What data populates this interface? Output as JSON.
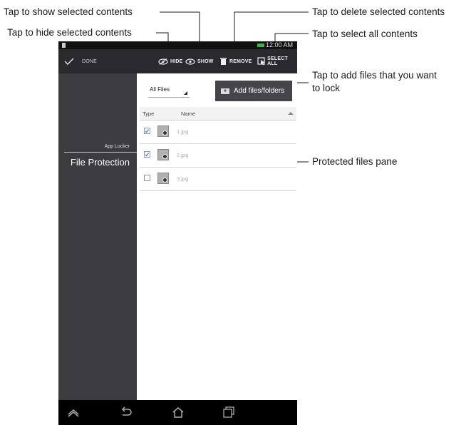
{
  "callouts": {
    "show": "Tap to show selected contents",
    "hide": "Tap to hide selected contents",
    "remove": "Tap to delete selected contents",
    "select_all": "Tap to select all contents",
    "add_line1": "Tap to add files that  you want",
    "add_line2": "to lock",
    "pane": "Protected files pane"
  },
  "status_bar": {
    "time": "12:00 AM"
  },
  "action_bar": {
    "done": "DONE",
    "hide": "HIDE",
    "show": "SHOW",
    "remove": "REMOVE",
    "select_all": "SELECT ALL"
  },
  "sidebar": {
    "section": "App Locker",
    "item": "File Protection"
  },
  "content": {
    "filter": "All Files",
    "add_button": "Add files/folders",
    "columns": {
      "type": "Type",
      "name": "Name"
    },
    "files": [
      {
        "name": "1.jpg",
        "checked": true
      },
      {
        "name": "2.jpg",
        "checked": true
      },
      {
        "name": "3.jpg",
        "checked": false
      }
    ]
  },
  "colors": {
    "callout_line": "#3b8ad9",
    "action_bar": "#2a2a2e",
    "sidebar": "#3c3c40"
  }
}
